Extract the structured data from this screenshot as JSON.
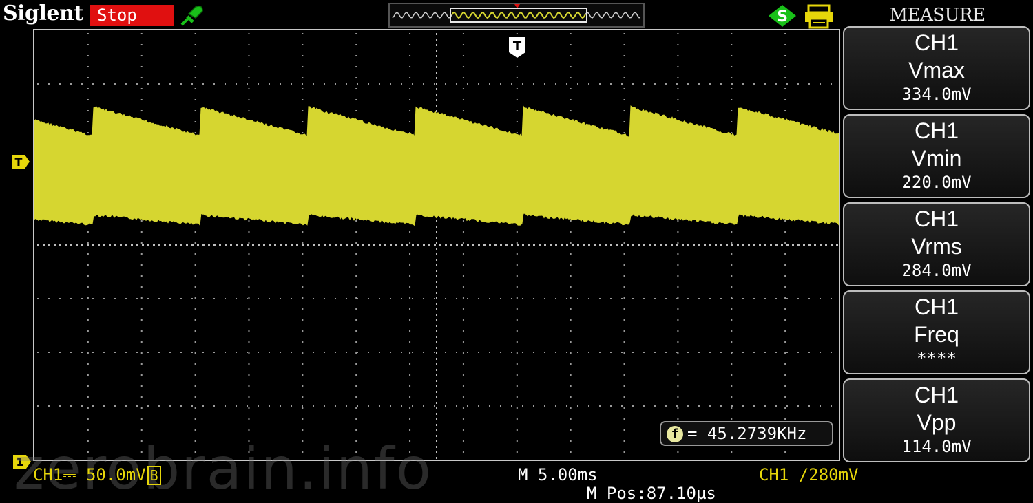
{
  "header": {
    "brand": "Siglent",
    "run_state": "Stop",
    "icons": [
      "plug-icon",
      "waveform-overview",
      "s-mode-icon",
      "print-icon"
    ]
  },
  "menu": {
    "title": "MEASURE",
    "items": [
      {
        "channel": "CH1",
        "label": "Vmax",
        "value": "334.0mV"
      },
      {
        "channel": "CH1",
        "label": "Vmin",
        "value": "220.0mV"
      },
      {
        "channel": "CH1",
        "label": "Vrms",
        "value": "284.0mV"
      },
      {
        "channel": "CH1",
        "label": "Freq",
        "value": "****"
      },
      {
        "channel": "CH1",
        "label": "Vpp",
        "value": "114.0mV"
      }
    ]
  },
  "screen": {
    "freq_readout": "= 45.2739KHz",
    "trigger_marker": "T",
    "channel_marker": "1"
  },
  "status": {
    "channel_scale": "CH1⎓ 50.0mV",
    "bw_limit": "B",
    "timebase": "M 5.00ms",
    "trigger": "CH1 ∕280mV",
    "position": "M Pos:87.10µs"
  },
  "watermark": "zerobrain.info",
  "colors": {
    "trace": "#d6d630",
    "stop": "#e01010",
    "green": "#19c019",
    "yellow": "#e6d60a"
  }
}
